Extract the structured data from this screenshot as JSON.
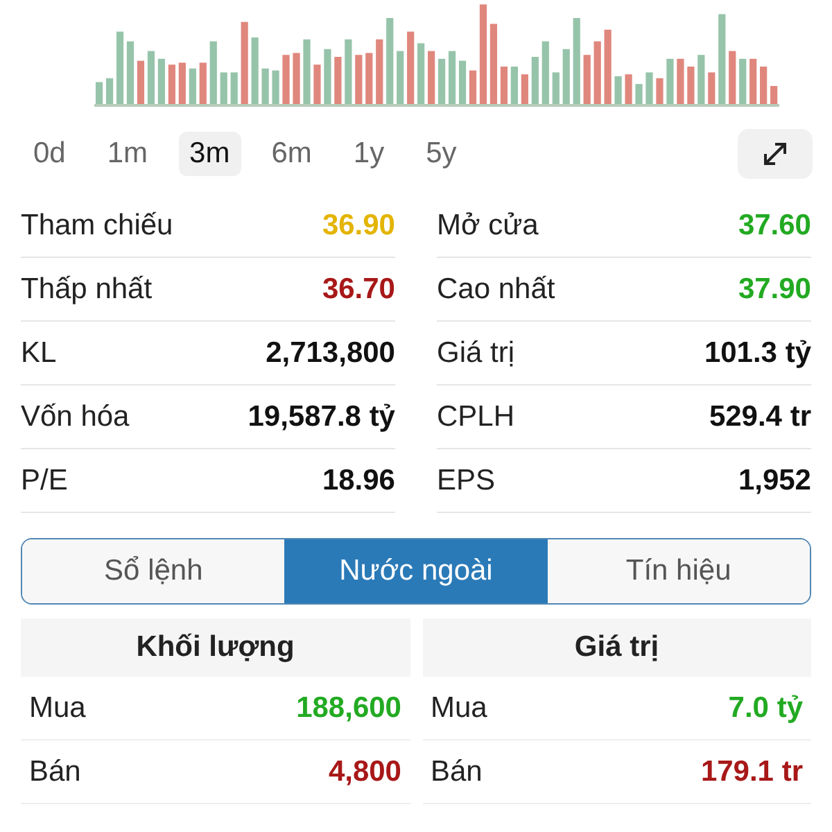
{
  "periods": [
    {
      "label": "0d",
      "selected": false
    },
    {
      "label": "1m",
      "selected": false
    },
    {
      "label": "3m",
      "selected": true
    },
    {
      "label": "6m",
      "selected": false
    },
    {
      "label": "1y",
      "selected": false
    },
    {
      "label": "5y",
      "selected": false
    }
  ],
  "stats": [
    [
      {
        "label": "Tham chiếu",
        "value": "36.90",
        "color": "#e3b400"
      },
      {
        "label": "Mở cửa",
        "value": "37.60",
        "color": "#22aa22"
      }
    ],
    [
      {
        "label": "Thấp nhất",
        "value": "36.70",
        "color": "#a81818"
      },
      {
        "label": "Cao nhất",
        "value": "37.90",
        "color": "#22aa22"
      }
    ],
    [
      {
        "label": "KL",
        "value": "2,713,800",
        "color": "#111111"
      },
      {
        "label": "Giá trị",
        "value": "101.3 tỷ",
        "color": "#111111"
      }
    ],
    [
      {
        "label": "Vốn hóa",
        "value": "19,587.8 tỷ",
        "color": "#111111"
      },
      {
        "label": "CPLH",
        "value": "529.4 tr",
        "color": "#111111"
      }
    ],
    [
      {
        "label": "P/E",
        "value": "18.96",
        "color": "#111111"
      },
      {
        "label": "EPS",
        "value": "1,952",
        "color": "#111111"
      }
    ]
  ],
  "tabs": [
    {
      "label": "Sổ lệnh",
      "selected": false
    },
    {
      "label": "Nước ngoài",
      "selected": true
    },
    {
      "label": "Tín hiệu",
      "selected": false
    }
  ],
  "foreign": [
    {
      "title": "Khối lượng",
      "rows": [
        {
          "label": "Mua",
          "value": "188,600",
          "color": "#22aa22"
        },
        {
          "label": "Bán",
          "value": "4,800",
          "color": "#a81818"
        }
      ]
    },
    {
      "title": "Giá trị",
      "rows": [
        {
          "label": "Mua",
          "value": "7.0 tỷ",
          "color": "#22aa22"
        },
        {
          "label": "Bán",
          "value": "179.1 tr",
          "color": "#a81818"
        }
      ]
    }
  ]
}
